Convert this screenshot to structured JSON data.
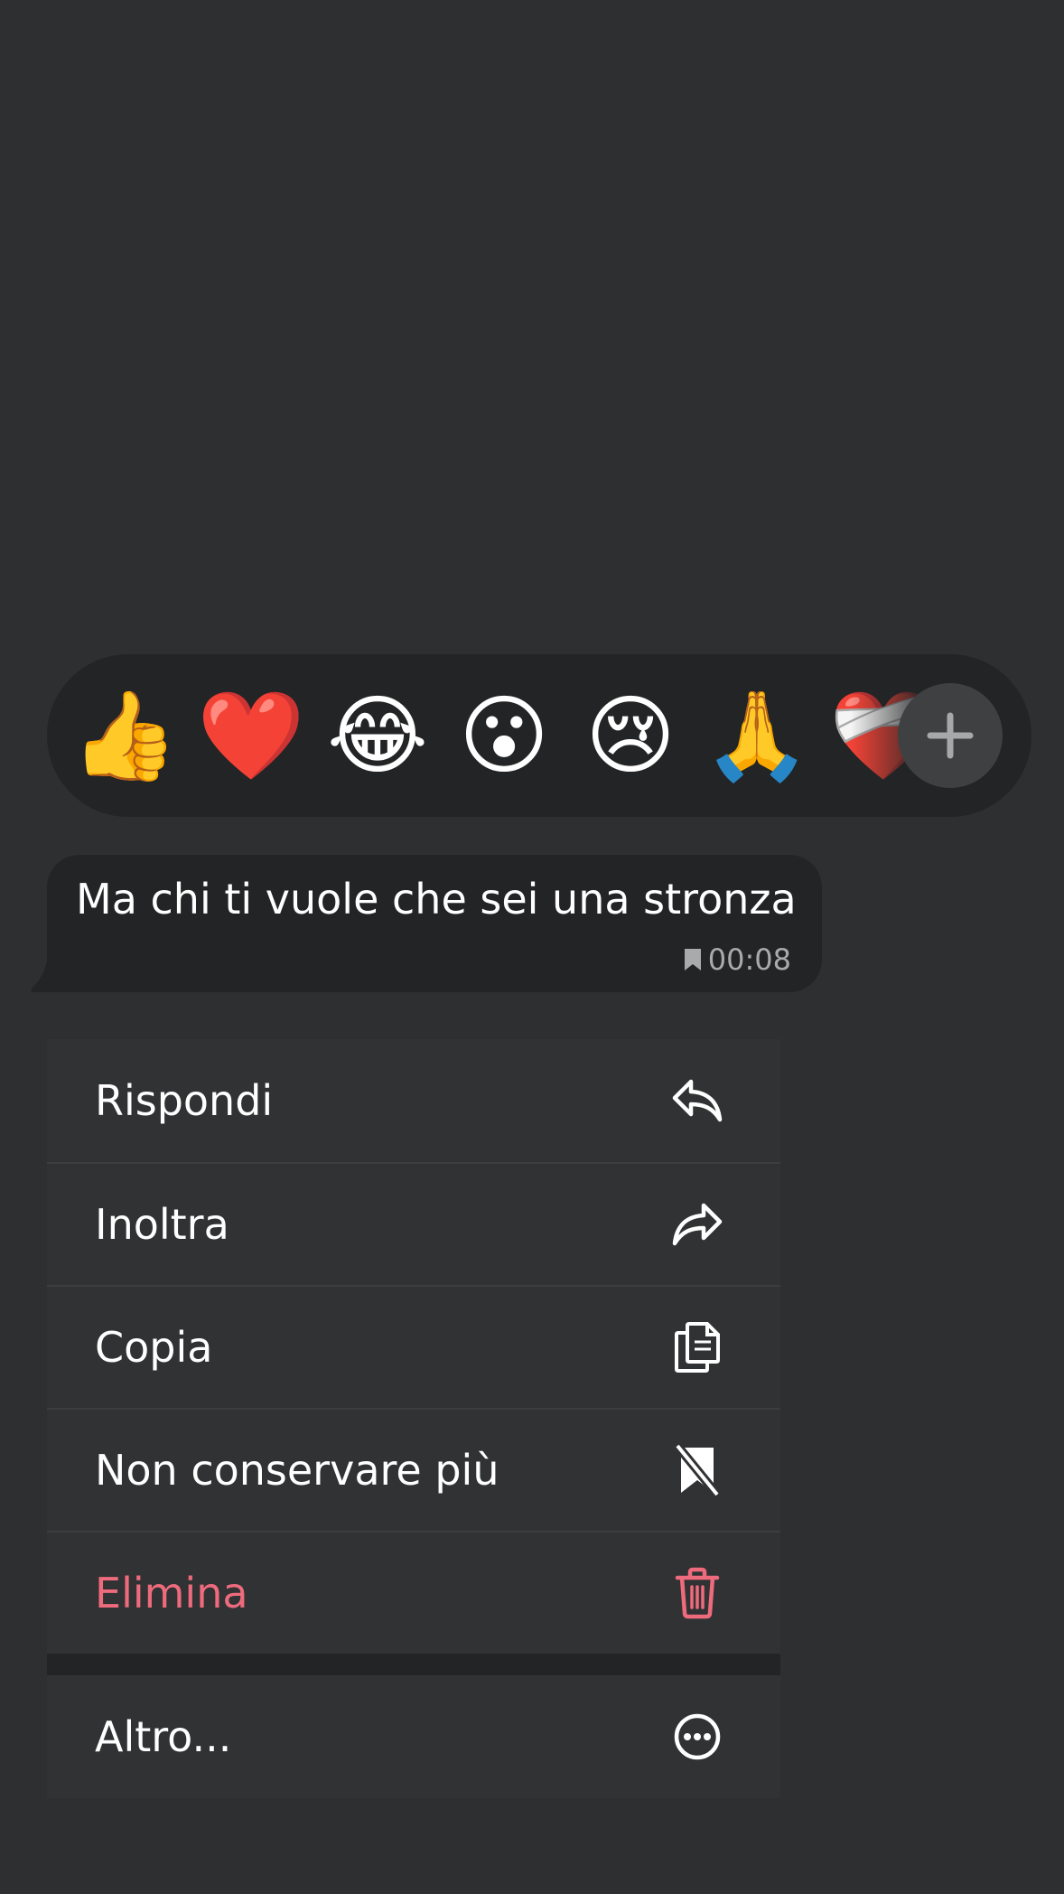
{
  "reactions": {
    "items": [
      {
        "name": "thumbs-up",
        "glyph": "👍"
      },
      {
        "name": "red-heart",
        "glyph": "❤️"
      },
      {
        "name": "tears-of-joy",
        "glyph": "😂"
      },
      {
        "name": "surprised",
        "glyph": "😮"
      },
      {
        "name": "crying",
        "glyph": "😢"
      },
      {
        "name": "folded-hands",
        "glyph": "🙏"
      },
      {
        "name": "mending-heart",
        "glyph": "❤️‍🩹"
      }
    ],
    "more_icon": "plus-icon"
  },
  "message": {
    "text": "Ma chi ti vuole che sei una stronza",
    "time": "00:08",
    "saved_icon": "bookmark-icon"
  },
  "menu": {
    "items": [
      {
        "label": "Rispondi",
        "icon": "reply-icon"
      },
      {
        "label": "Inoltra",
        "icon": "forward-icon"
      },
      {
        "label": "Copia",
        "icon": "copy-icon"
      },
      {
        "label": "Non conservare più",
        "icon": "unbookmark-icon"
      },
      {
        "label": "Elimina",
        "icon": "trash-icon",
        "danger": true
      }
    ],
    "more": {
      "label": "Altro...",
      "icon": "more-icon"
    }
  },
  "colors": {
    "background": "#2e2f30",
    "bubble": "#232425",
    "menu": "#313233",
    "danger": "#ee6b7d"
  }
}
